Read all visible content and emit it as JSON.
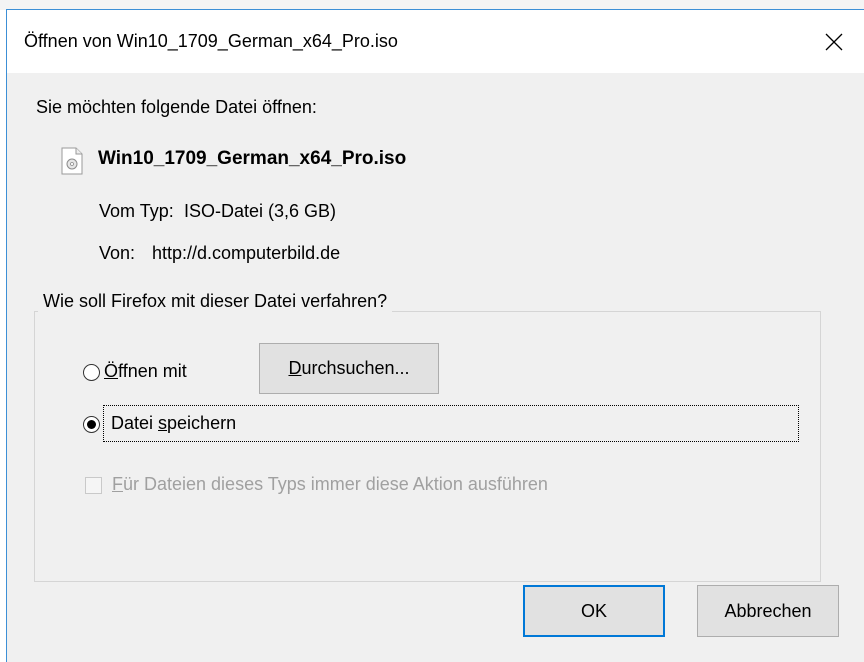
{
  "dialog": {
    "title": "Öffnen von Win10_1709_German_x64_Pro.iso",
    "intro": "Sie möchten folgende Datei öffnen:",
    "file": {
      "name": "Win10_1709_German_x64_Pro.iso",
      "type_label": "Vom Typ:",
      "type_value": "ISO-Datei (3,6 GB)",
      "from_label": "Von:",
      "from_value": "http://d.computerbild.de"
    },
    "action_group": {
      "legend": "Wie soll Firefox mit dieser Datei verfahren?",
      "open_with": {
        "prefix": "",
        "mnemonic": "Ö",
        "rest": "ffnen mit",
        "selected": false
      },
      "browse_button": {
        "mnemonic": "D",
        "rest": "urchsuchen..."
      },
      "save_file": {
        "prefix": "Datei ",
        "mnemonic": "s",
        "rest": "peichern",
        "selected": true
      },
      "always_checkbox": {
        "mnemonic": "F",
        "rest": "ür Dateien dieses Typs immer diese Aktion ausführen",
        "checked": false,
        "enabled": false
      }
    },
    "buttons": {
      "ok": "OK",
      "cancel": "Abbrechen"
    }
  },
  "icons": {
    "close": "close-icon",
    "file": "file-icon"
  },
  "colors": {
    "accent": "#0078d7",
    "window_border": "#3c8fd6",
    "dialog_bg": "#f0f0f0"
  }
}
